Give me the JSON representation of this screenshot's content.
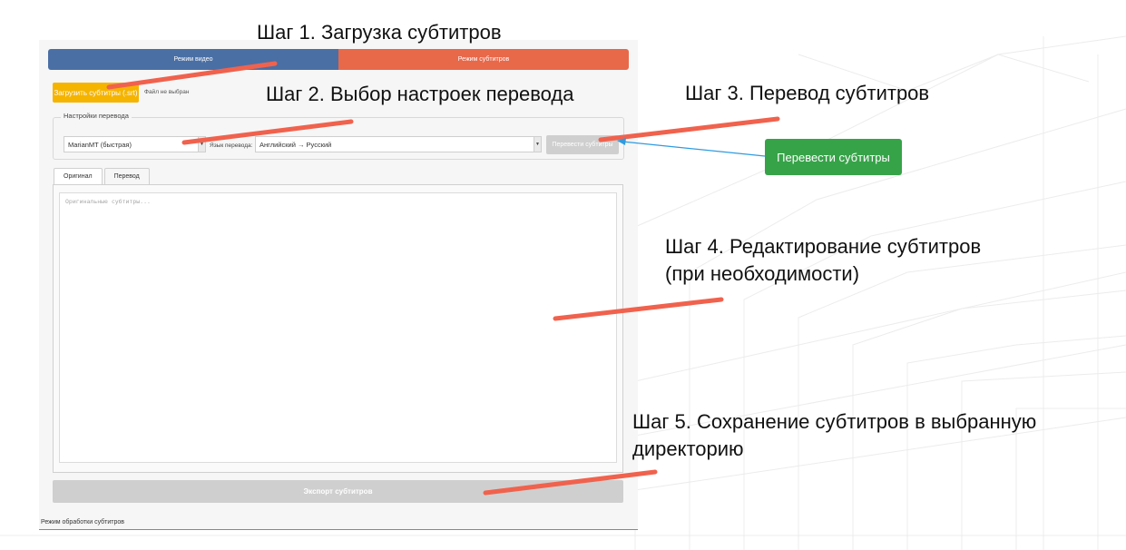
{
  "app": {
    "mode_video": "Режим видео",
    "mode_subtitles": "Режим субтитров",
    "upload_button": "Загрузить субтитры (.srt)",
    "file_status": "Файл не выбран",
    "settings_legend": "Настройки перевода",
    "model_value": "MarianMT (быстрая)",
    "language_label": "Язык перевода:",
    "language_value": "Английский → Русский",
    "translate_button": "Перевести субтитры",
    "tabs": [
      {
        "label": "Оригинал",
        "active": true
      },
      {
        "label": "Перевод",
        "active": false
      }
    ],
    "textarea_placeholder": "Оригинальные субтитры...",
    "export_button": "Экспорт субтитров",
    "status_text": "Режим обработки субтитров"
  },
  "annotations": {
    "step1": "Шаг 1. Загрузка субтитров",
    "step2": "Шаг 2. Выбор настроек перевода",
    "step3": "Шаг 3. Перевод субтитров",
    "step4_line1": "Шаг 4. Редактирование субтитров",
    "step4_line2": "(при необходимости)",
    "step5_line1": "Шаг 5. Сохранение субтитров в выбранную",
    "step5_line2": "директорию",
    "highlight_button": "Перевести субтитры"
  },
  "colors": {
    "mode_video": "#4a6fa5",
    "mode_subtitles": "#e8684a",
    "upload": "#f5b400",
    "disabled": "#cfcfcf",
    "green": "#37a349",
    "arrow_red": "#f0624d",
    "arrow_blue": "#2f9be0"
  }
}
